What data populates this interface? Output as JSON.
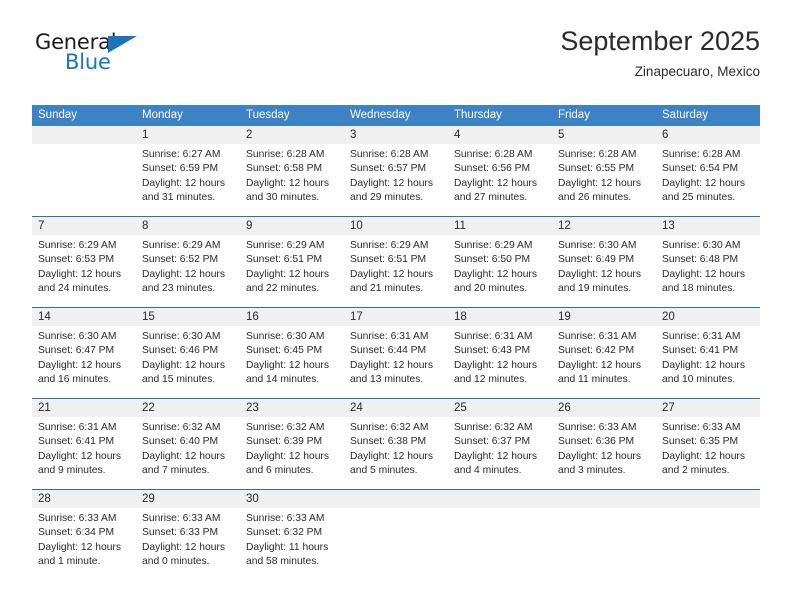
{
  "brand": {
    "name_part1": "General",
    "name_part2": "Blue",
    "accent_color": "#1b74bb"
  },
  "header": {
    "title": "September 2025",
    "subtitle": "Zinapecuaro, Mexico"
  },
  "calendar": {
    "header_color": "#3c82c4",
    "weekdays": [
      "Sunday",
      "Monday",
      "Tuesday",
      "Wednesday",
      "Thursday",
      "Friday",
      "Saturday"
    ],
    "weeks": [
      [
        {
          "day": "",
          "lines": []
        },
        {
          "day": "1",
          "lines": [
            "Sunrise: 6:27 AM",
            "Sunset: 6:59 PM",
            "Daylight: 12 hours",
            "and 31 minutes."
          ]
        },
        {
          "day": "2",
          "lines": [
            "Sunrise: 6:28 AM",
            "Sunset: 6:58 PM",
            "Daylight: 12 hours",
            "and 30 minutes."
          ]
        },
        {
          "day": "3",
          "lines": [
            "Sunrise: 6:28 AM",
            "Sunset: 6:57 PM",
            "Daylight: 12 hours",
            "and 29 minutes."
          ]
        },
        {
          "day": "4",
          "lines": [
            "Sunrise: 6:28 AM",
            "Sunset: 6:56 PM",
            "Daylight: 12 hours",
            "and 27 minutes."
          ]
        },
        {
          "day": "5",
          "lines": [
            "Sunrise: 6:28 AM",
            "Sunset: 6:55 PM",
            "Daylight: 12 hours",
            "and 26 minutes."
          ]
        },
        {
          "day": "6",
          "lines": [
            "Sunrise: 6:28 AM",
            "Sunset: 6:54 PM",
            "Daylight: 12 hours",
            "and 25 minutes."
          ]
        }
      ],
      [
        {
          "day": "7",
          "lines": [
            "Sunrise: 6:29 AM",
            "Sunset: 6:53 PM",
            "Daylight: 12 hours",
            "and 24 minutes."
          ]
        },
        {
          "day": "8",
          "lines": [
            "Sunrise: 6:29 AM",
            "Sunset: 6:52 PM",
            "Daylight: 12 hours",
            "and 23 minutes."
          ]
        },
        {
          "day": "9",
          "lines": [
            "Sunrise: 6:29 AM",
            "Sunset: 6:51 PM",
            "Daylight: 12 hours",
            "and 22 minutes."
          ]
        },
        {
          "day": "10",
          "lines": [
            "Sunrise: 6:29 AM",
            "Sunset: 6:51 PM",
            "Daylight: 12 hours",
            "and 21 minutes."
          ]
        },
        {
          "day": "11",
          "lines": [
            "Sunrise: 6:29 AM",
            "Sunset: 6:50 PM",
            "Daylight: 12 hours",
            "and 20 minutes."
          ]
        },
        {
          "day": "12",
          "lines": [
            "Sunrise: 6:30 AM",
            "Sunset: 6:49 PM",
            "Daylight: 12 hours",
            "and 19 minutes."
          ]
        },
        {
          "day": "13",
          "lines": [
            "Sunrise: 6:30 AM",
            "Sunset: 6:48 PM",
            "Daylight: 12 hours",
            "and 18 minutes."
          ]
        }
      ],
      [
        {
          "day": "14",
          "lines": [
            "Sunrise: 6:30 AM",
            "Sunset: 6:47 PM",
            "Daylight: 12 hours",
            "and 16 minutes."
          ]
        },
        {
          "day": "15",
          "lines": [
            "Sunrise: 6:30 AM",
            "Sunset: 6:46 PM",
            "Daylight: 12 hours",
            "and 15 minutes."
          ]
        },
        {
          "day": "16",
          "lines": [
            "Sunrise: 6:30 AM",
            "Sunset: 6:45 PM",
            "Daylight: 12 hours",
            "and 14 minutes."
          ]
        },
        {
          "day": "17",
          "lines": [
            "Sunrise: 6:31 AM",
            "Sunset: 6:44 PM",
            "Daylight: 12 hours",
            "and 13 minutes."
          ]
        },
        {
          "day": "18",
          "lines": [
            "Sunrise: 6:31 AM",
            "Sunset: 6:43 PM",
            "Daylight: 12 hours",
            "and 12 minutes."
          ]
        },
        {
          "day": "19",
          "lines": [
            "Sunrise: 6:31 AM",
            "Sunset: 6:42 PM",
            "Daylight: 12 hours",
            "and 11 minutes."
          ]
        },
        {
          "day": "20",
          "lines": [
            "Sunrise: 6:31 AM",
            "Sunset: 6:41 PM",
            "Daylight: 12 hours",
            "and 10 minutes."
          ]
        }
      ],
      [
        {
          "day": "21",
          "lines": [
            "Sunrise: 6:31 AM",
            "Sunset: 6:41 PM",
            "Daylight: 12 hours",
            "and 9 minutes."
          ]
        },
        {
          "day": "22",
          "lines": [
            "Sunrise: 6:32 AM",
            "Sunset: 6:40 PM",
            "Daylight: 12 hours",
            "and 7 minutes."
          ]
        },
        {
          "day": "23",
          "lines": [
            "Sunrise: 6:32 AM",
            "Sunset: 6:39 PM",
            "Daylight: 12 hours",
            "and 6 minutes."
          ]
        },
        {
          "day": "24",
          "lines": [
            "Sunrise: 6:32 AM",
            "Sunset: 6:38 PM",
            "Daylight: 12 hours",
            "and 5 minutes."
          ]
        },
        {
          "day": "25",
          "lines": [
            "Sunrise: 6:32 AM",
            "Sunset: 6:37 PM",
            "Daylight: 12 hours",
            "and 4 minutes."
          ]
        },
        {
          "day": "26",
          "lines": [
            "Sunrise: 6:33 AM",
            "Sunset: 6:36 PM",
            "Daylight: 12 hours",
            "and 3 minutes."
          ]
        },
        {
          "day": "27",
          "lines": [
            "Sunrise: 6:33 AM",
            "Sunset: 6:35 PM",
            "Daylight: 12 hours",
            "and 2 minutes."
          ]
        }
      ],
      [
        {
          "day": "28",
          "lines": [
            "Sunrise: 6:33 AM",
            "Sunset: 6:34 PM",
            "Daylight: 12 hours",
            "and 1 minute."
          ]
        },
        {
          "day": "29",
          "lines": [
            "Sunrise: 6:33 AM",
            "Sunset: 6:33 PM",
            "Daylight: 12 hours",
            "and 0 minutes."
          ]
        },
        {
          "day": "30",
          "lines": [
            "Sunrise: 6:33 AM",
            "Sunset: 6:32 PM",
            "Daylight: 11 hours",
            "and 58 minutes."
          ]
        },
        {
          "day": "",
          "lines": []
        },
        {
          "day": "",
          "lines": []
        },
        {
          "day": "",
          "lines": []
        },
        {
          "day": "",
          "lines": []
        }
      ]
    ]
  }
}
